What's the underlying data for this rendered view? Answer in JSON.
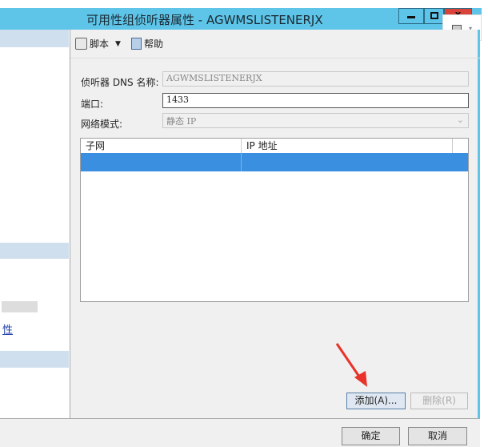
{
  "window": {
    "title": "可用性组侦听器属性 - AGWMSLISTENERJX",
    "close_label": "x"
  },
  "toolbar": {
    "script_label": "脚本",
    "help_label": "帮助"
  },
  "form": {
    "dns_label": "侦听器 DNS 名称:",
    "dns_value": "AGWMSLISTENERJX",
    "port_label": "端口:",
    "port_value": "1433",
    "network_label": "网络模式:",
    "network_value": "静态 IP"
  },
  "grid": {
    "columns": [
      "子网",
      "IP 地址"
    ]
  },
  "buttons": {
    "add": "添加(A)...",
    "remove": "删除(R)",
    "ok": "确定",
    "cancel": "取消"
  },
  "left_panel": {
    "link": "性"
  },
  "annotation": {
    "arrow_color": "#e8322a"
  }
}
